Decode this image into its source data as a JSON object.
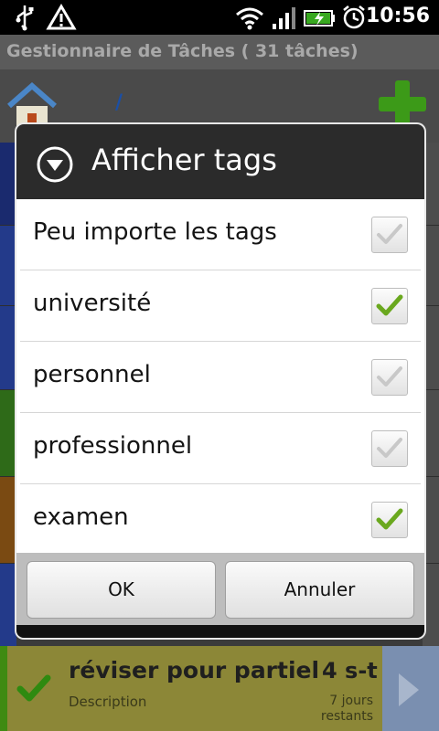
{
  "status_bar": {
    "time": "10:56",
    "icons": [
      "usb-icon",
      "warning-icon",
      "wifi-icon",
      "signal-icon",
      "battery-charging-icon",
      "alarm-icon"
    ]
  },
  "app": {
    "title": "Gestionnaire de Tâches ( 31 tâches)"
  },
  "toolbar": {
    "separator": "/",
    "icons": [
      "home-icon",
      "add-icon"
    ]
  },
  "dialog": {
    "title": "Afficher tags",
    "options": [
      {
        "label": "Peu importe les tags",
        "checked": false
      },
      {
        "label": "université",
        "checked": true
      },
      {
        "label": "personnel",
        "checked": false
      },
      {
        "label": "professionnel",
        "checked": false
      },
      {
        "label": "examen",
        "checked": true
      }
    ],
    "ok_label": "OK",
    "cancel_label": "Annuler"
  },
  "task": {
    "title": "réviser pour partiel",
    "description": "Description",
    "due": "4 s-t",
    "remaining_line1": "7 jours",
    "remaining_line2": "restants"
  },
  "colors": {
    "check_green": "#6aa81e",
    "check_gray": "#c8c8c8",
    "add_green": "#3c9a18"
  }
}
